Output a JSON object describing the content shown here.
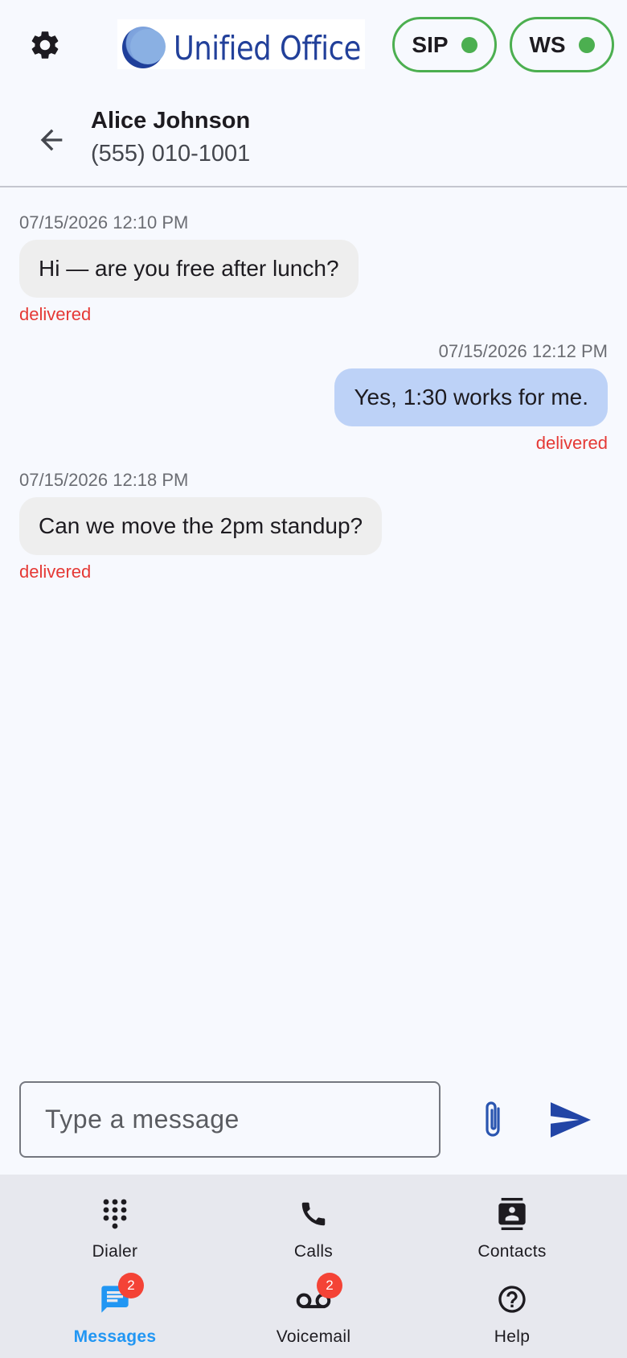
{
  "topbar": {
    "logo_text": "Unified Office",
    "sip_label": "SIP",
    "ws_label": "WS",
    "status_color": "#4caf50",
    "icons": [
      "gear-icon"
    ]
  },
  "contact": {
    "name": "Alice Johnson",
    "phone": "(555) 010-1001"
  },
  "messages": [
    {
      "direction": "incoming",
      "timestamp": "07/15/2026 12:10 PM",
      "text": "Hi — are you free after lunch?",
      "status": "delivered"
    },
    {
      "direction": "outgoing",
      "timestamp": "07/15/2026 12:12 PM",
      "text": "Yes, 1:30 works for me.",
      "status": "delivered"
    },
    {
      "direction": "incoming",
      "timestamp": "07/15/2026 12:18 PM",
      "text": "Can we move the 2pm standup?",
      "status": "delivered"
    }
  ],
  "composer": {
    "placeholder": "Type a message",
    "value": ""
  },
  "nav": {
    "items": [
      {
        "label": "Dialer",
        "icon": "dialpad-icon"
      },
      {
        "label": "Calls",
        "icon": "phone-icon"
      },
      {
        "label": "Contacts",
        "icon": "contacts-icon"
      },
      {
        "label": "Messages",
        "icon": "message-icon",
        "badge": "2",
        "active": true
      },
      {
        "label": "Voicemail",
        "icon": "voicemail-icon",
        "badge": "2"
      },
      {
        "label": "Help",
        "icon": "help-icon"
      }
    ]
  },
  "colors": {
    "accent": "#2196f3",
    "outgoing_bubble": "#bdd2f7",
    "incoming_bubble": "#eeeeee",
    "delivered": "#e53935",
    "badge": "#f44336"
  }
}
